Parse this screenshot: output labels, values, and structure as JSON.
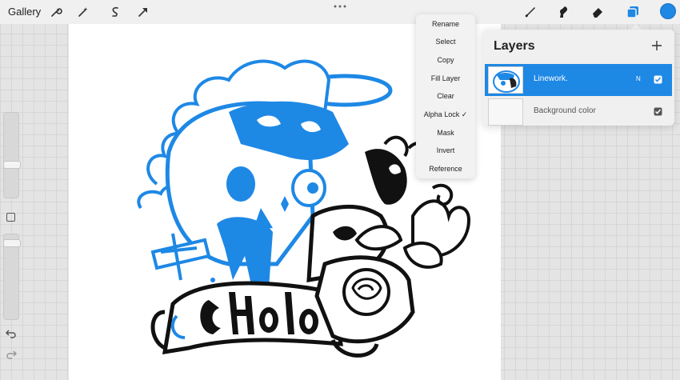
{
  "topbar": {
    "gallery_label": "Gallery",
    "tools_left": [
      "wrench-icon",
      "magic-wand-icon",
      "selection-icon",
      "transform-arrow-icon"
    ],
    "tools_right": [
      "brush-icon",
      "smudge-icon",
      "eraser-icon",
      "layers-icon"
    ],
    "color": "#1e88e5"
  },
  "context_menu": {
    "items": [
      "Rename",
      "Select",
      "Copy",
      "Fill Layer",
      "Clear",
      "Alpha Lock ✓",
      "Mask",
      "Invert",
      "Reference"
    ]
  },
  "layers_panel": {
    "title": "Layers",
    "add_icon": "plus-icon",
    "layers": [
      {
        "name": "Linework.",
        "blend_mode": "N",
        "visible": true,
        "selected": true
      },
      {
        "name": "Background color",
        "visible": true,
        "selected": false
      }
    ]
  },
  "colors": {
    "accent": "#1e88e5",
    "linework_blue": "#1e88e5",
    "linework_black": "#111111"
  }
}
